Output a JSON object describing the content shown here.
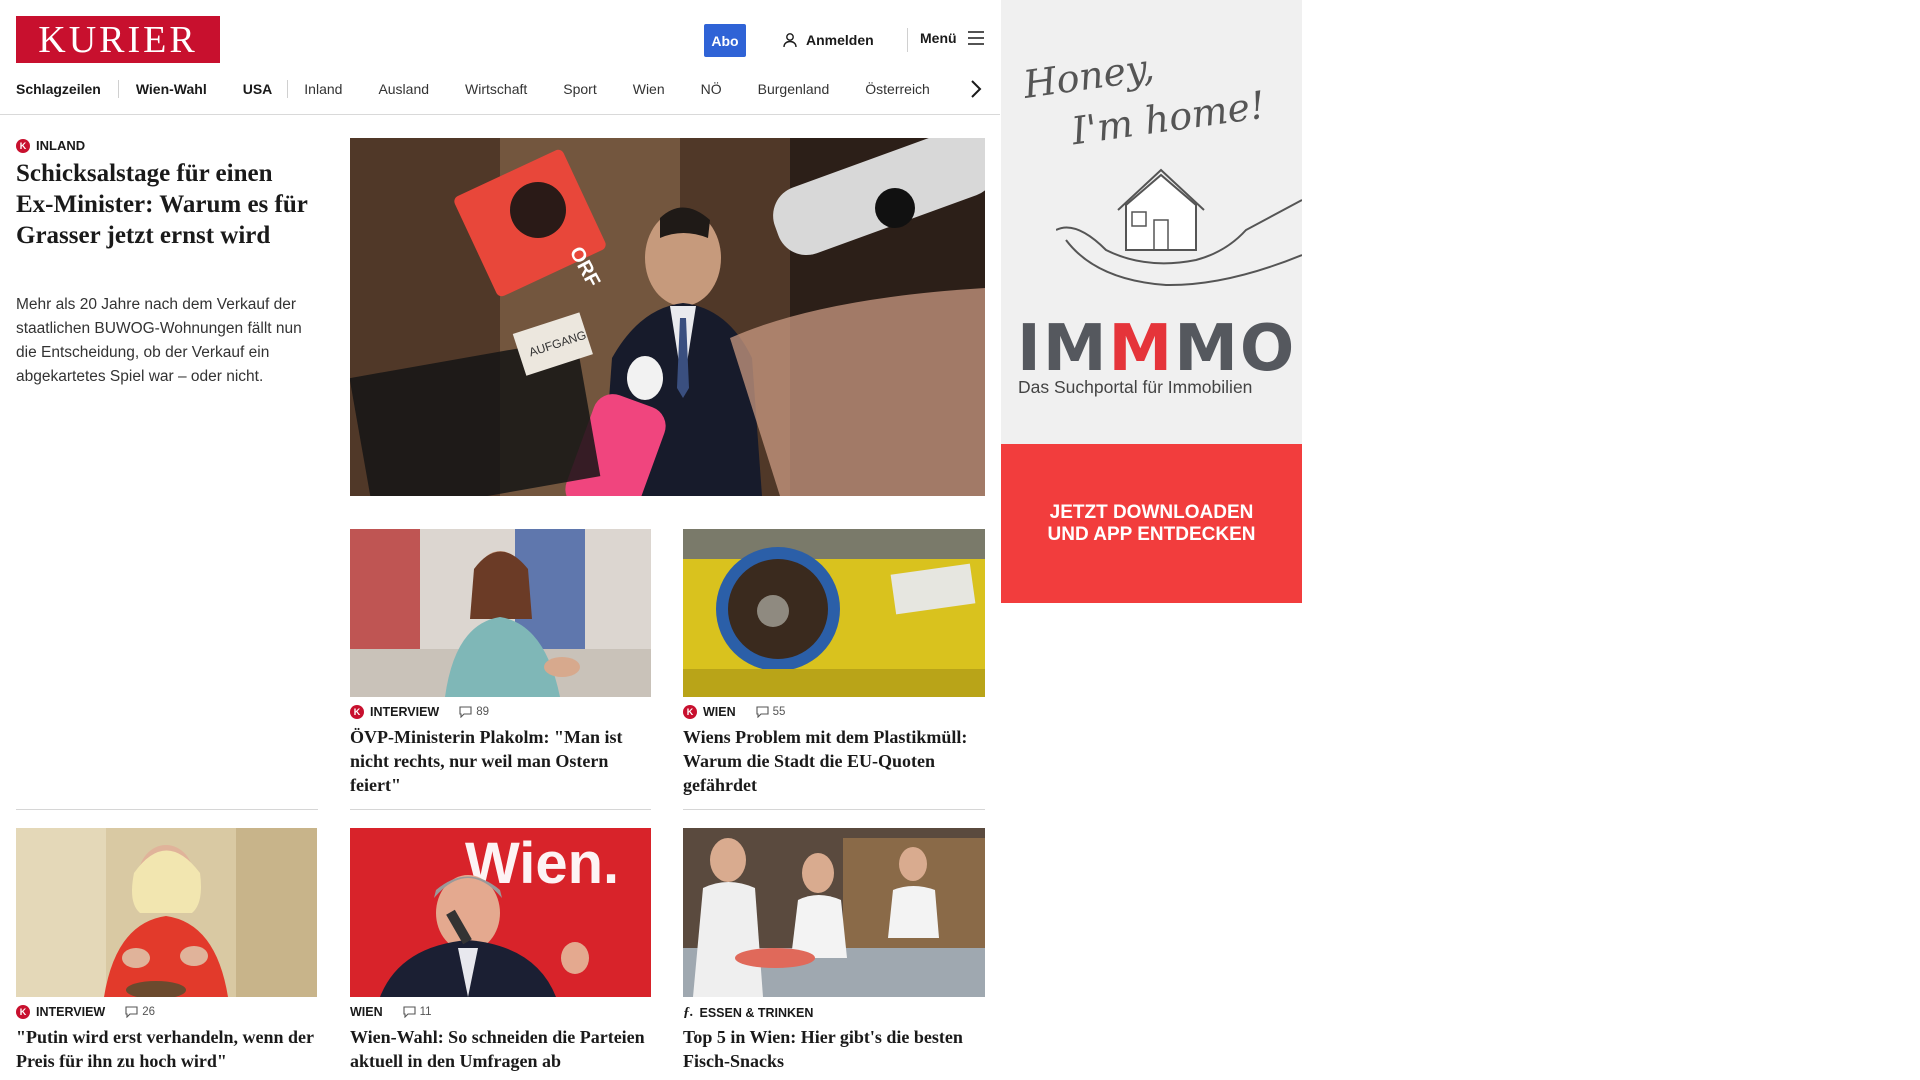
{
  "header": {
    "logo_text": "KURIER",
    "abo_label": "Abo",
    "login_label": "Anmelden",
    "menu_label": "Menü"
  },
  "nav": {
    "items": [
      "Schlagzeilen",
      "Wien-Wahl",
      "USA",
      "Inland",
      "Ausland",
      "Wirtschaft",
      "Sport",
      "Wien",
      "NÖ",
      "Burgenland",
      "Österreich"
    ]
  },
  "lead": {
    "kicker": "INLAND",
    "title": "Schicksalstage für einen Ex-Minister: Warum es für Grasser jetzt ernst wird",
    "teaser": "Mehr als 20 Jahre nach dem Verkauf der staatlichen BUWOG-Wohnungen fällt nun die Entscheidung, ob der Verkauf ein abgekartetes Spiel war – oder nicht."
  },
  "cards": [
    {
      "kicker": "INTERVIEW",
      "comments": "89",
      "title": "ÖVP-Ministerin Plakolm: \"Man ist nicht rechts, nur weil man Ostern feiert\""
    },
    {
      "kicker": "WIEN",
      "comments": "55",
      "title": "Wiens Problem mit dem Plastikmüll: Warum die Stadt die EU-Quoten gefährdet"
    },
    {
      "kicker": "INTERVIEW",
      "comments": "26",
      "title": "\"Putin wird erst verhandeln, wenn der Preis für ihn zu hoch wird\""
    },
    {
      "kicker": "WIEN",
      "comments": "11",
      "title": "Wien-Wahl: So schneiden die Parteien aktuell in den Umfragen ab"
    },
    {
      "kicker": "ESSEN & TRINKEN",
      "comments": "",
      "title": "Top 5 in Wien: Hier gibt's die besten Fisch-Snacks"
    }
  ],
  "hero_signs": {
    "sign_a": "AUFGANG",
    "sign_b": "ORF"
  },
  "card4_sign": "Wien.",
  "ad": {
    "script_line1": "Honey,",
    "script_line2": "I'm home!",
    "brand_pre": "IM",
    "brand_m": "M",
    "brand_post": "MO",
    "tagline": "Das Suchportal für Immobilien",
    "cta": "JETZT DOWNLOADEN\nUND APP ENTDECKEN"
  },
  "colors": {
    "brand_red": "#c8102e",
    "abo_blue": "#2f63d6",
    "ad_red": "#f23d3d"
  }
}
